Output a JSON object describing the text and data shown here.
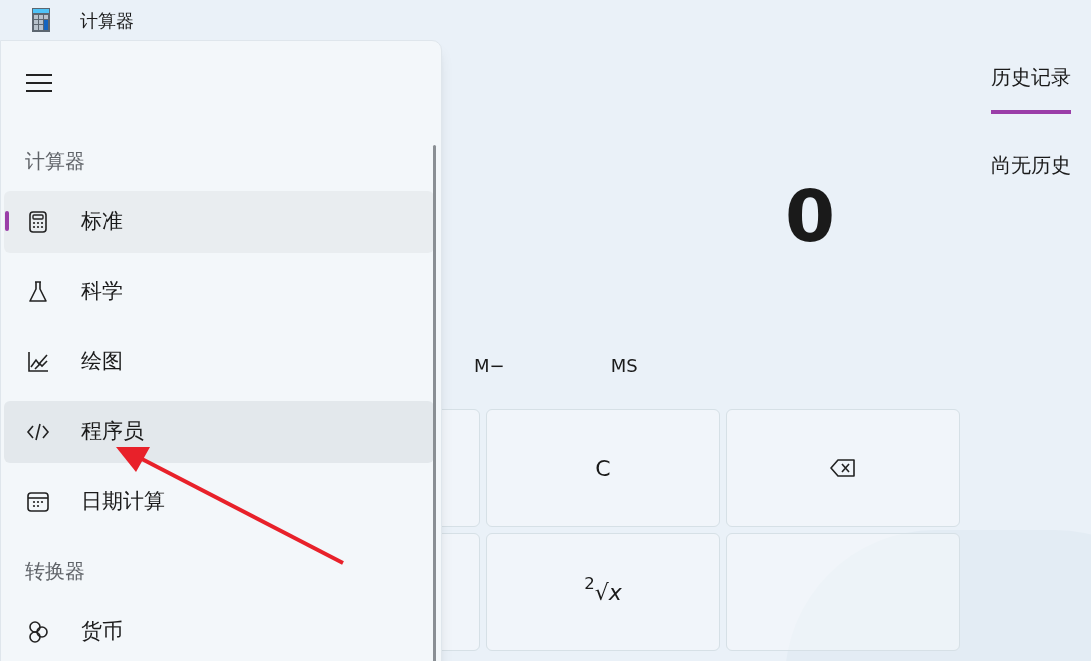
{
  "window": {
    "title": "计算器"
  },
  "nav": {
    "sections": [
      {
        "heading": "计算器",
        "items": [
          {
            "label": "标准",
            "selected": true,
            "hovered": false
          },
          {
            "label": "科学",
            "selected": false,
            "hovered": false
          },
          {
            "label": "绘图",
            "selected": false,
            "hovered": false
          },
          {
            "label": "程序员",
            "selected": false,
            "hovered": true
          },
          {
            "label": "日期计算",
            "selected": false,
            "hovered": false
          }
        ]
      },
      {
        "heading": "转换器",
        "items": [
          {
            "label": "货币",
            "selected": false,
            "hovered": false
          }
        ]
      }
    ]
  },
  "display": {
    "value": "0"
  },
  "memory": [
    "M−",
    "MS"
  ],
  "keys": [
    {
      "kind": "blank"
    },
    {
      "kind": "text",
      "label": "C"
    },
    {
      "kind": "backspace"
    },
    {
      "kind": "blank"
    },
    {
      "kind": "text",
      "label": "$^{2}$√*x*"
    },
    {
      "kind": "blank"
    }
  ],
  "history": {
    "tabs": [
      {
        "label": "历史记录",
        "selected": true
      }
    ],
    "empty_text": "尚无历史"
  }
}
